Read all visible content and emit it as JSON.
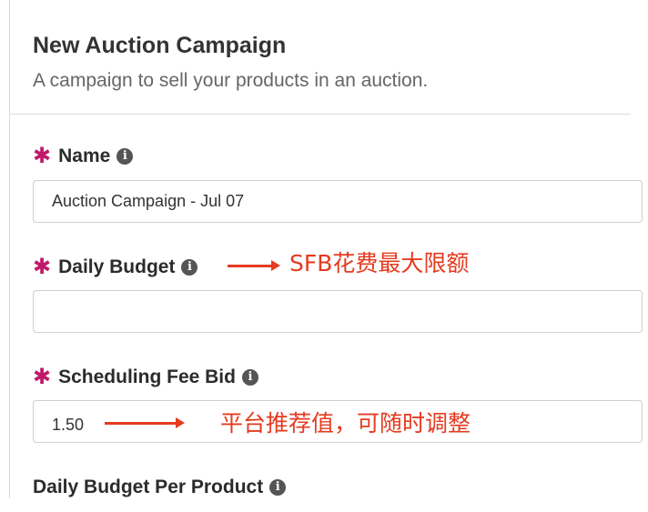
{
  "header": {
    "title": "New Auction Campaign",
    "subtitle": "A campaign to sell your products in an auction."
  },
  "fields": {
    "name": {
      "label": "Name",
      "required": true,
      "value": "Auction Campaign - Jul 07"
    },
    "daily_budget": {
      "label": "Daily Budget",
      "required": true,
      "value": ""
    },
    "scheduling_fee_bid": {
      "label": "Scheduling Fee Bid",
      "required": true,
      "value": "1.50"
    },
    "daily_budget_per_product": {
      "label": "Daily Budget Per Product",
      "required": false
    }
  },
  "icons": {
    "required": "asterisk-icon",
    "info": "info-icon",
    "required_glyph": "✱",
    "info_glyph": "i"
  },
  "annotations": {
    "daily_budget_note": "SFB花费最大限额",
    "fee_bid_note": "平台推荐值，可随时调整"
  },
  "colors": {
    "required_marker": "#c0196a",
    "annotation": "#e53b1f"
  }
}
